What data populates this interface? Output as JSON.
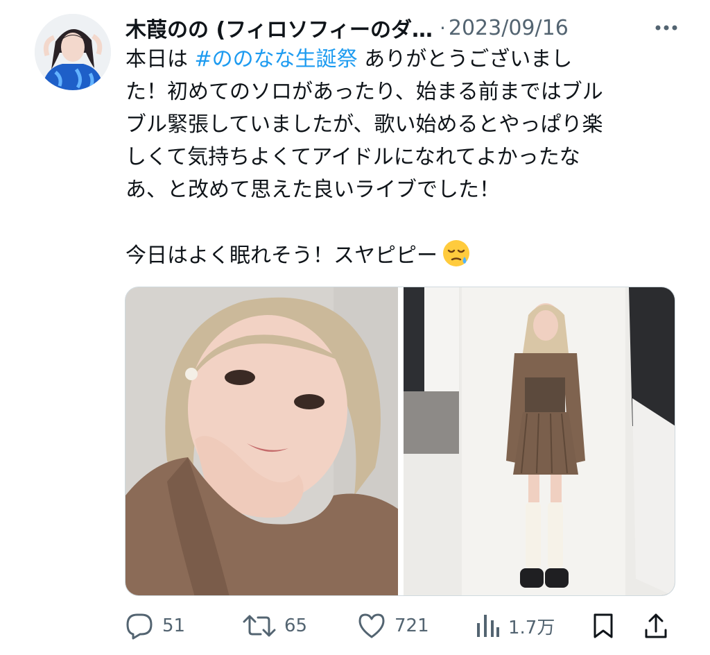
{
  "tweet": {
    "author": {
      "display_name": "木葭のの (フィロソフィーのダ…",
      "avatar_icon": "profile-photo"
    },
    "separator": "·",
    "timestamp": "2023/09/16",
    "more_icon": "more-dots-icon",
    "text": {
      "line1_before": "本日は ",
      "line1_hashtag": "#ののなな生誕祭",
      "line1_after": " ありがとうございまし",
      "line2": "た！初めてのソロがあったり、始まる前まではブル",
      "line3": "ブル緊張していましたが、歌い始めるとやっぱり楽",
      "line4": "しくて気持ちよくてアイドルになれてよかったな",
      "line5": "あ、と改めて思えた良いライブでした！",
      "line7": "今日はよく眠れそう！スヤピピー",
      "emoji": "sleepy-face-emoji"
    },
    "media": [
      {
        "kind": "photo",
        "subject": "selfie"
      },
      {
        "kind": "photo",
        "subject": "full-body-outfit"
      }
    ],
    "actions": {
      "replies": "51",
      "retweets": "65",
      "likes": "721",
      "views": "1.7万"
    }
  },
  "colors": {
    "text": "#0f1419",
    "secondary": "#536471",
    "link": "#1d9bf0",
    "border": "#cfd9de"
  }
}
